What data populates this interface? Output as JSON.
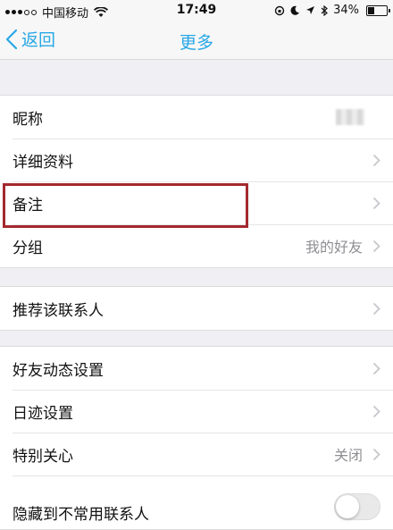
{
  "status_bar": {
    "carrier": "中国移动",
    "time": "17:49",
    "battery": "34%",
    "battery_level": 0.34
  },
  "nav": {
    "back_label": "返回",
    "title": "更多"
  },
  "groups": [
    {
      "rows": [
        {
          "label": "昵称",
          "value": ""
        },
        {
          "label": "详细资料",
          "value": ""
        },
        {
          "label": "备注",
          "value": ""
        },
        {
          "label": "分组",
          "value": "我的好友"
        }
      ]
    },
    {
      "rows": [
        {
          "label": "推荐该联系人",
          "value": ""
        }
      ]
    },
    {
      "rows": [
        {
          "label": "好友动态设置",
          "value": ""
        },
        {
          "label": "日迹设置",
          "value": ""
        },
        {
          "label": "特别关心",
          "value": "关闭"
        },
        {
          "label": "隐藏到不常用联系人",
          "value": ""
        }
      ]
    }
  ],
  "colors": {
    "accent": "#27a7e7",
    "highlight": "#a4282e"
  }
}
